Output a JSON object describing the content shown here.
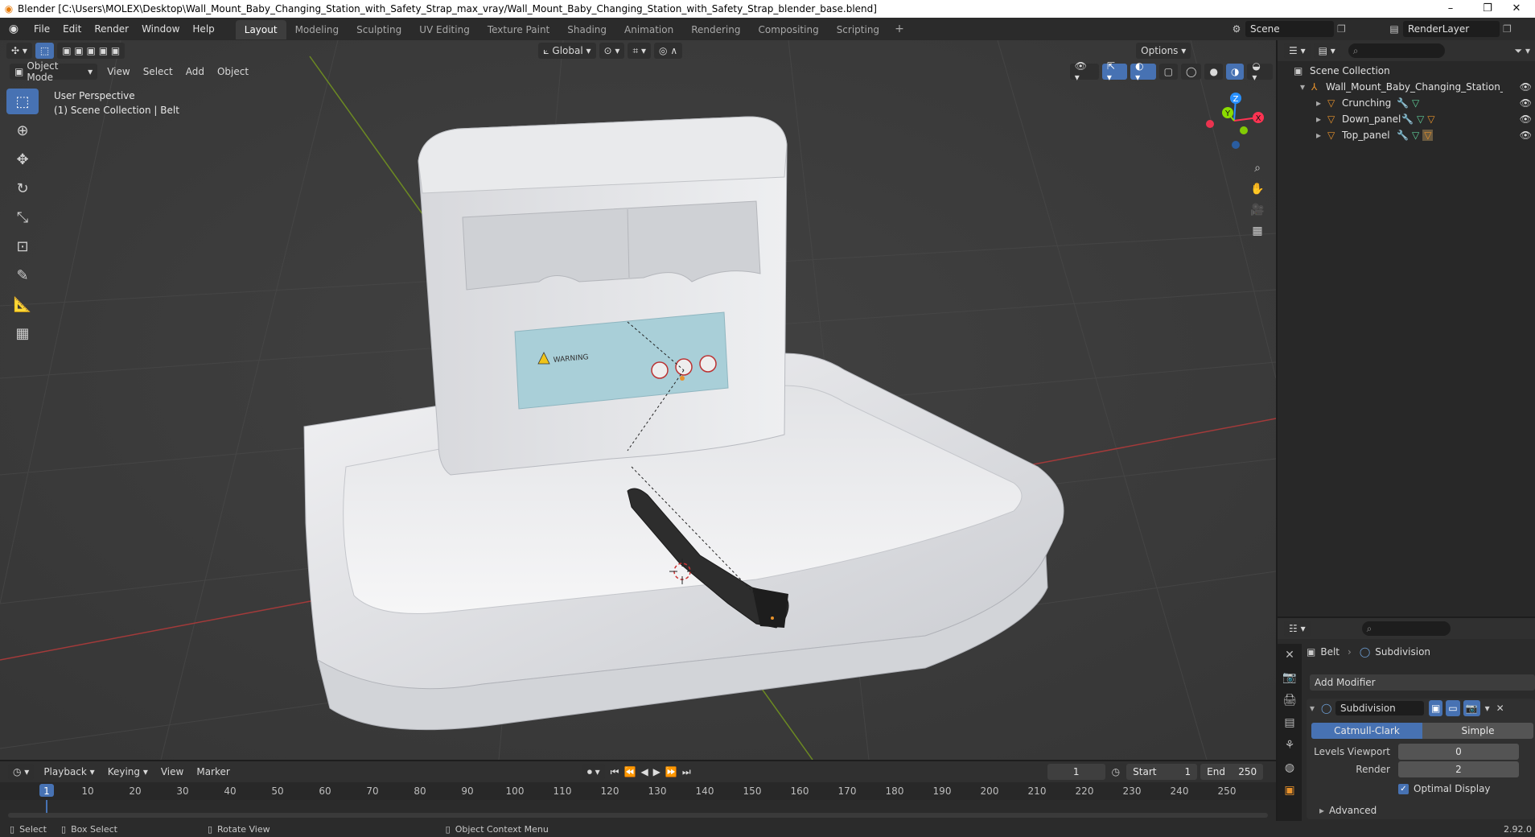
{
  "window": {
    "title": "Blender [C:\\Users\\MOLEX\\Desktop\\Wall_Mount_Baby_Changing_Station_with_Safety_Strap_max_vray/Wall_Mount_Baby_Changing_Station_with_Safety_Strap_blender_base.blend]",
    "minimize": "–",
    "restore": "❐",
    "close": "✕"
  },
  "menu": [
    "File",
    "Edit",
    "Render",
    "Window",
    "Help"
  ],
  "workspaces": [
    "Layout",
    "Modeling",
    "Sculpting",
    "UV Editing",
    "Texture Paint",
    "Shading",
    "Animation",
    "Rendering",
    "Compositing",
    "Scripting"
  ],
  "scene": {
    "scene_name": "Scene",
    "view_layer": "RenderLayer"
  },
  "viewport_header": {
    "mode": "Object Mode",
    "menus": [
      "View",
      "Select",
      "Add",
      "Object"
    ],
    "orientation": "Global",
    "options": "Options"
  },
  "viewport": {
    "perspective": "User Perspective",
    "collection_info": "(1) Scene Collection | Belt",
    "gizmo_axes": [
      "Z",
      "Y",
      "X"
    ]
  },
  "outliner": {
    "root": "Scene Collection",
    "collection": "Wall_Mount_Baby_Changing_Station_with_Sa",
    "objects": [
      "Crunching",
      "Down_panel",
      "Top_panel"
    ]
  },
  "properties": {
    "object": "Belt",
    "modifier_tab": "Subdivision",
    "add_modifier": "Add Modifier",
    "modifier_name": "Subdivision",
    "type_options": [
      "Catmull-Clark",
      "Simple"
    ],
    "levels_viewport_label": "Levels Viewport",
    "levels_viewport": "0",
    "render_label": "Render",
    "render": "2",
    "optimal_display": "Optimal Display",
    "advanced": "Advanced"
  },
  "timeline": {
    "menus": [
      "Playback",
      "Keying",
      "View",
      "Marker"
    ],
    "current_frame": "1",
    "start_label": "Start",
    "start": "1",
    "end_label": "End",
    "end": "250",
    "ticks": [
      "1",
      "10",
      "20",
      "30",
      "40",
      "50",
      "60",
      "70",
      "80",
      "90",
      "100",
      "110",
      "120",
      "130",
      "140",
      "150",
      "160",
      "170",
      "180",
      "190",
      "200",
      "210",
      "220",
      "230",
      "240",
      "250"
    ]
  },
  "statusbar": {
    "select": "Select",
    "box_select": "Box Select",
    "rotate_view": "Rotate View",
    "context_menu": "Object Context Menu",
    "version": "2.92.0"
  },
  "warning_label": {
    "title": "WARNING"
  },
  "colors": {
    "accent": "#4772b3",
    "x_axis": "#ff3352",
    "y_axis": "#8bdc00",
    "z_axis": "#2890ff",
    "object_orange": "#e8922c"
  }
}
